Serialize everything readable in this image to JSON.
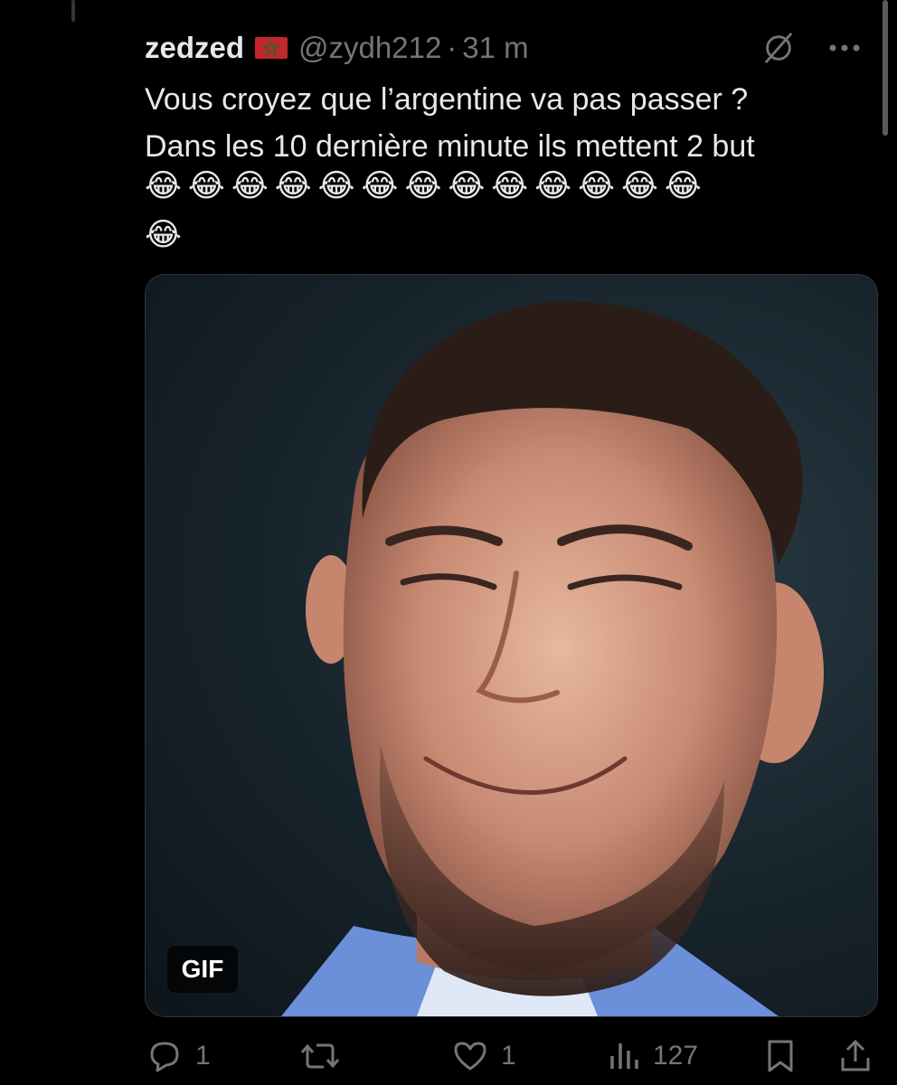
{
  "tweet": {
    "display_name": "zedzed",
    "flag": "Morocco flag",
    "handle": "@zydh212",
    "separator": "·",
    "time": "31 m",
    "text": "Vous croyez que l’argentine va pas passer ?\nDans les 10 dernière minute ils mettent 2 but",
    "emoji_row_1": [
      "😂",
      "😂",
      "😂",
      "😂",
      "😂",
      "😂",
      "😂",
      "😂",
      "😂",
      "😂",
      "😂",
      "😂",
      "😂"
    ],
    "emoji_row_2": [
      "😂"
    ],
    "media": {
      "type": "GIF",
      "badge": "GIF",
      "description_icon": "photo-of-smiling-footballer"
    },
    "actions": {
      "replies": "1",
      "reposts": "",
      "likes": "1",
      "views": "127"
    }
  },
  "icons": {
    "grok": "grok-icon",
    "more": "more-icon",
    "reply": "reply-icon",
    "repost": "repost-icon",
    "like": "heart-icon",
    "views": "views-icon",
    "bookmark": "bookmark-icon",
    "share": "share-icon"
  },
  "colors": {
    "background": "#000000",
    "text": "#e7e9ea",
    "secondary": "#71767b"
  }
}
